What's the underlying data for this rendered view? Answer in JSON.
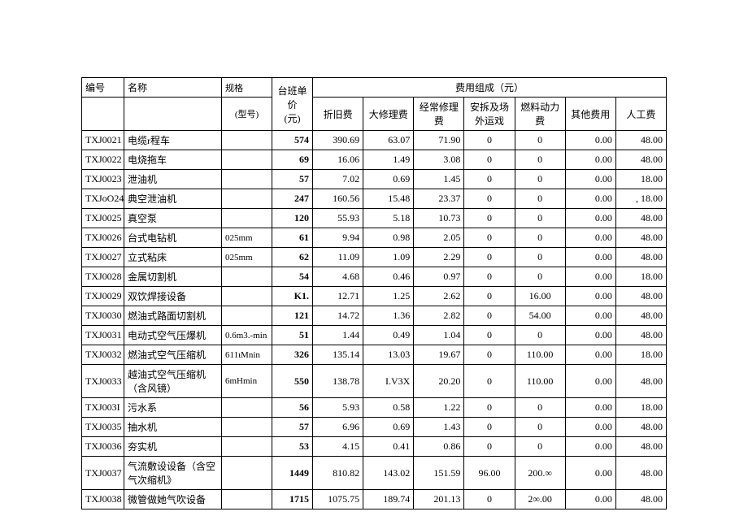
{
  "headers": {
    "id": "编号",
    "name": "名称",
    "spec": "规格",
    "spec_sub": "(型号)",
    "price": "台班单价",
    "price_unit": "(元)",
    "group": "费用组成（元）",
    "f1": "折旧费",
    "f2": "大修理费",
    "f3": "经常修理费",
    "f4": "安拆及场外运戏",
    "f5": "燃料动力费",
    "f6": "其他费用",
    "f7": "人工费"
  },
  "rows": [
    {
      "id": "TXJ0021",
      "name": "电缆r程车",
      "spec": "",
      "price": "574",
      "f1": "390.69",
      "f2": "63.07",
      "f3": "71.90",
      "f4": "0",
      "f5": "0",
      "f6": "0.00",
      "f7": "48.00",
      "tall": false
    },
    {
      "id": "TXJ0022",
      "name": "电烧拖车",
      "spec": "",
      "price": "69",
      "f1": "16.06",
      "f2": "1.49",
      "f3": "3.08",
      "f4": "0",
      "f5": "0",
      "f6": "0.00",
      "f7": "48.00",
      "tall": false
    },
    {
      "id": "TXJ0023",
      "name": "泄油机",
      "spec": "",
      "price": "57",
      "f1": "7.02",
      "f2": "0.69",
      "f3": "1.45",
      "f4": "0",
      "f5": "0",
      "f6": "0.00",
      "f7": "18.00",
      "tall": false
    },
    {
      "id": "TXJoO24",
      "name": "典空泄油机",
      "spec": "",
      "price": "247",
      "f1": "160.56",
      "f2": "15.48",
      "f3": "23.37",
      "f4": "0",
      "f5": "0",
      "f6": "0.00",
      "f7": ", 18.00",
      "tall": false
    },
    {
      "id": "TXJ0025",
      "name": "真空泵",
      "spec": "",
      "price": "120",
      "f1": "55.93",
      "f2": "5.18",
      "f3": "10.73",
      "f4": "0",
      "f5": "0",
      "f6": "0.00",
      "f7": "48.00",
      "tall": false
    },
    {
      "id": "TXJ0026",
      "name": "台式电钻机",
      "spec": "025mm",
      "price": "61",
      "f1": "9.94",
      "f2": "0.98",
      "f3": "2.05",
      "f4": "0",
      "f5": "0",
      "f6": "0.00",
      "f7": "48.00",
      "tall": false
    },
    {
      "id": "TXJ0027",
      "name": "立式粘床",
      "spec": "025mm",
      "price": "62",
      "f1": "11.09",
      "f2": "1.09",
      "f3": "2.29",
      "f4": "0",
      "f5": "0",
      "f6": "0.00",
      "f7": "48.00",
      "tall": false
    },
    {
      "id": "TXJ0028",
      "name": "金属切割机",
      "spec": "",
      "price": "54",
      "f1": "4.68",
      "f2": "0.46",
      "f3": "0.97",
      "f4": "0",
      "f5": "0",
      "f6": "0.00",
      "f7": "18.00",
      "tall": false
    },
    {
      "id": "TXJ0029",
      "name": "双饮焊接设备",
      "spec": "",
      "price": "K1.",
      "f1": "12.71",
      "f2": "1.25",
      "f3": "2.62",
      "f4": "0",
      "f5": "16.00",
      "f6": "0.00",
      "f7": "48.00",
      "tall": false
    },
    {
      "id": "TXJ0030",
      "name": "燃油式路面切割机",
      "spec": "",
      "price": "121",
      "f1": "14.72",
      "f2": "1.36",
      "f3": "2.82",
      "f4": "0",
      "f5": "54.00",
      "f6": "0.00",
      "f7": "48.00",
      "tall": false
    },
    {
      "id": "TXJ0031",
      "name": "电动式空气压爆机",
      "spec": "0.6m3.-min",
      "price": "51",
      "f1": "1.44",
      "f2": "0.49",
      "f3": "1.04",
      "f4": "0",
      "f5": "0",
      "f6": "0.00",
      "f7": "48.00",
      "tall": false
    },
    {
      "id": "TXJ0032",
      "name": "燃油式空气压缩机",
      "spec": "611ιMnin",
      "price": "326",
      "f1": "135.14",
      "f2": "13.03",
      "f3": "19.67",
      "f4": "0",
      "f5": "110.00",
      "f6": "0.00",
      "f7": "18.00",
      "tall": false
    },
    {
      "id": "TXJ0033",
      "name": "越油式空气压缩机（含风镜）",
      "spec": "6mHmin",
      "price": "550",
      "f1": "138.78",
      "f2": "I.V3X",
      "f3": "20.20",
      "f4": "0",
      "f5": "110.00",
      "f6": "0.00",
      "f7": "48.00",
      "tall": true
    },
    {
      "id": "TXJ003I",
      "name": "污水系",
      "spec": "",
      "price": "56",
      "f1": "5.93",
      "f2": "0.58",
      "f3": "1.22",
      "f4": "0",
      "f5": "0",
      "f6": "0.00",
      "f7": "18.00",
      "tall": false
    },
    {
      "id": "TXJ0035",
      "name": "抽水机",
      "spec": "",
      "price": "57",
      "f1": "6.96",
      "f2": "0.69",
      "f3": "1.43",
      "f4": "0",
      "f5": "0",
      "f6": "0.00",
      "f7": "48.00",
      "tall": false
    },
    {
      "id": "TXJ0036",
      "name": "夯实机",
      "spec": "",
      "price": "53",
      "f1": "4.15",
      "f2": "0.41",
      "f3": "0.86",
      "f4": "0",
      "f5": "0",
      "f6": "0.00",
      "f7": "48.00",
      "tall": false
    },
    {
      "id": "TXJ0037",
      "name": "气流敷设设备（含空气次缩机》",
      "spec": "",
      "price": "1449",
      "f1": "810.82",
      "f2": "143.02",
      "f3": "151.59",
      "f4": "96.00",
      "f5": "200.∞",
      "f6": "0.00",
      "f7": "48.00",
      "tall": true
    },
    {
      "id": "TXJ0038",
      "name": "微管做她气吹设备",
      "spec": "",
      "price": "1715",
      "f1": "1075.75",
      "f2": "189.74",
      "f3": "201.13",
      "f4": "0",
      "f5": "2∞.00",
      "f6": "0.00",
      "f7": "48.00",
      "tall": false
    }
  ]
}
